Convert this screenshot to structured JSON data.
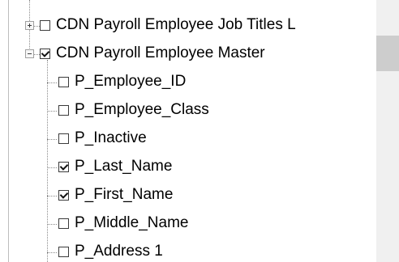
{
  "tree": {
    "items": [
      {
        "label": "CDN Payroll Employee Job Titles L",
        "checked": false,
        "expander": "plus"
      },
      {
        "label": "CDN Payroll Employee Master",
        "checked": true,
        "expander": "minus"
      },
      {
        "label": "P_Employee_ID",
        "checked": false
      },
      {
        "label": "P_Employee_Class",
        "checked": false
      },
      {
        "label": "P_Inactive",
        "checked": false
      },
      {
        "label": "P_Last_Name",
        "checked": true
      },
      {
        "label": "P_First_Name",
        "checked": true
      },
      {
        "label": "P_Middle_Name",
        "checked": false
      },
      {
        "label": "P_Address 1",
        "checked": false
      }
    ]
  },
  "scrollbar": {
    "position": 0.2
  },
  "colors": {
    "dotted_line": "#8a8a8a",
    "scroll_thumb": "#cdcdcd",
    "scroll_track": "#f0f0f0"
  }
}
